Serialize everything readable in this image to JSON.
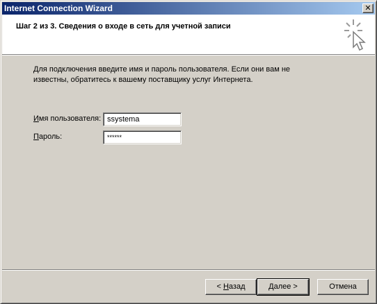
{
  "window": {
    "title": "Internet Connection Wizard",
    "close_glyph": "✕"
  },
  "header": {
    "title": "Шаг 2 из 3. Сведения о входе в сеть для учетной записи",
    "icon": "wizard-cursor-icon"
  },
  "content": {
    "intro_line1": "Для подключения введите имя и пароль пользователя. Если они вам не",
    "intro_line2": "известны, обратитесь к вашему поставщику услуг Интернета.",
    "username": {
      "label_accel": "И",
      "label_rest": "мя пользователя:",
      "value": "ssystema"
    },
    "password": {
      "label_accel": "П",
      "label_rest": "ароль:",
      "value": "******"
    }
  },
  "buttons": {
    "back_prefix": "< ",
    "back_accel": "Н",
    "back_rest": "азад",
    "next_accel": "Д",
    "next_rest": "алее >",
    "cancel": "Отмена"
  }
}
